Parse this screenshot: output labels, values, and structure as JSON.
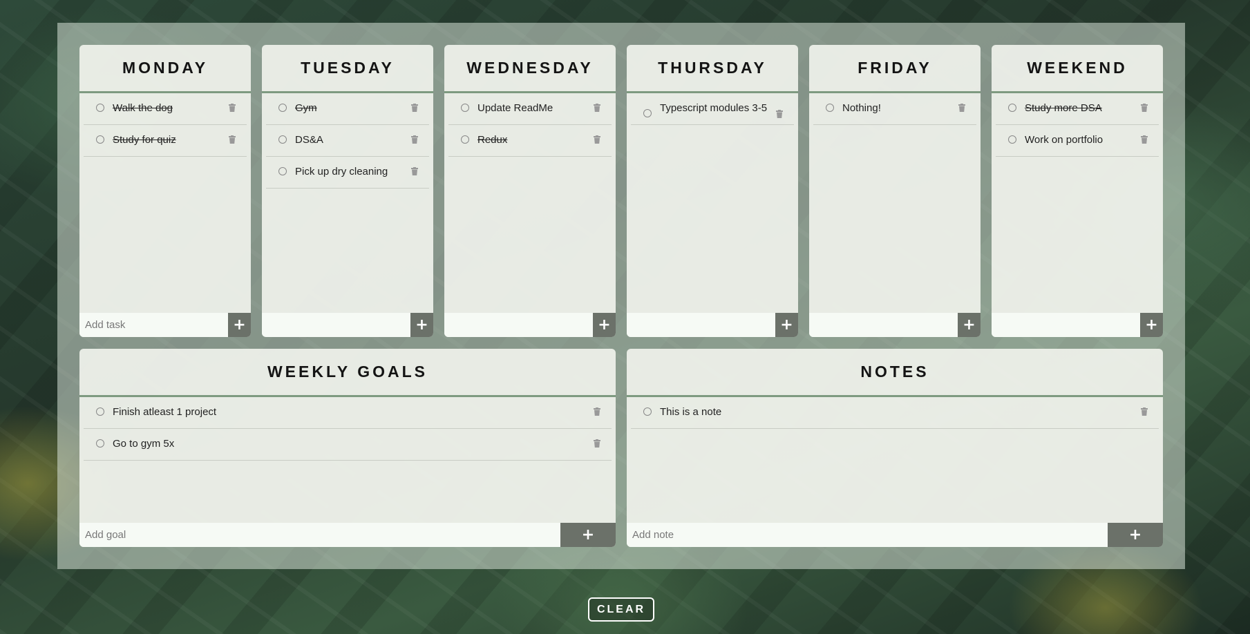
{
  "days": [
    {
      "title": "MONDAY",
      "placeholder": "Add task",
      "tasks": [
        {
          "text": "Walk the dog",
          "done": true
        },
        {
          "text": "Study for quiz",
          "done": true
        }
      ]
    },
    {
      "title": "TUESDAY",
      "placeholder": "",
      "tasks": [
        {
          "text": "Gym",
          "done": true
        },
        {
          "text": "DS&A",
          "done": false
        },
        {
          "text": "Pick up dry cleaning",
          "done": false
        }
      ]
    },
    {
      "title": "WEDNESDAY",
      "placeholder": "",
      "tasks": [
        {
          "text": "Update ReadMe",
          "done": false
        },
        {
          "text": "Redux",
          "done": true
        }
      ]
    },
    {
      "title": "THURSDAY",
      "placeholder": "",
      "tasks": [
        {
          "text": "Typescript modules 3-5",
          "done": false
        }
      ]
    },
    {
      "title": "FRIDAY",
      "placeholder": "",
      "tasks": [
        {
          "text": "Nothing!",
          "done": false
        }
      ]
    },
    {
      "title": "WEEKEND",
      "placeholder": "",
      "tasks": [
        {
          "text": "Study more DSA",
          "done": true
        },
        {
          "text": "Work on portfolio",
          "done": false
        }
      ]
    }
  ],
  "goals": {
    "title": "WEEKLY GOALS",
    "placeholder": "Add goal",
    "items": [
      {
        "text": "Finish atleast 1 project",
        "done": false
      },
      {
        "text": "Go to gym 5x",
        "done": false
      }
    ]
  },
  "notes": {
    "title": "NOTES",
    "placeholder": "Add note",
    "items": [
      {
        "text": "This is a note",
        "done": false
      }
    ]
  },
  "add_label": "+",
  "clear_label": "CLEAR",
  "colors": {
    "accent": "#7e9a80",
    "button": "#6b7169",
    "trash": "#999999"
  }
}
